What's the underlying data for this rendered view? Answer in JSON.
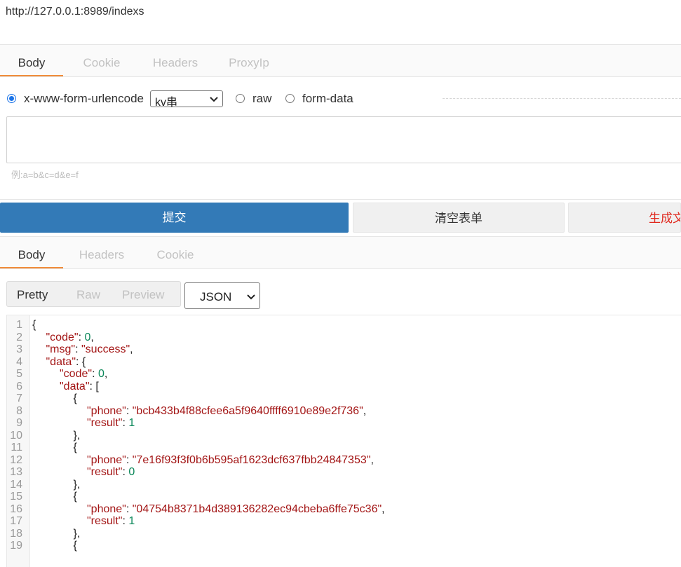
{
  "url": "http://127.0.0.1:8989/indexs",
  "request_tabs": [
    "Body",
    "Cookie",
    "Headers",
    "ProxyIp"
  ],
  "body_options": {
    "urlencode_label": "x-www-form-urlencode",
    "urlencode_select_value": "kv串",
    "raw_label": "raw",
    "formdata_label": "form-data"
  },
  "textarea_hint": "例:a=b&c=d&e=f",
  "buttons": {
    "submit": "提交",
    "clear": "清空表单",
    "generate": "生成文"
  },
  "response_tabs": [
    "Body",
    "Headers",
    "Cookie"
  ],
  "view_modes": [
    "Pretty",
    "Raw",
    "Preview"
  ],
  "format_select_value": "JSON",
  "colors": {
    "primary": "#337ab7",
    "tab_underline": "#f08c3a",
    "danger_text": "#e0281d",
    "json_key": "#a31515",
    "json_number": "#098658"
  },
  "code_lines": [
    {
      "n": "1",
      "indent": 0,
      "parts": [
        [
          "p",
          "{"
        ]
      ]
    },
    {
      "n": "2",
      "indent": 1,
      "parts": [
        [
          "k",
          "\"code\""
        ],
        [
          "p",
          ": "
        ],
        [
          "n",
          "0"
        ],
        [
          "p",
          ","
        ]
      ]
    },
    {
      "n": "3",
      "indent": 1,
      "parts": [
        [
          "k",
          "\"msg\""
        ],
        [
          "p",
          ": "
        ],
        [
          "s",
          "\"success\""
        ],
        [
          "p",
          ","
        ]
      ]
    },
    {
      "n": "4",
      "indent": 1,
      "parts": [
        [
          "k",
          "\"data\""
        ],
        [
          "p",
          ": {"
        ]
      ]
    },
    {
      "n": "5",
      "indent": 2,
      "parts": [
        [
          "k",
          "\"code\""
        ],
        [
          "p",
          ": "
        ],
        [
          "n",
          "0"
        ],
        [
          "p",
          ","
        ]
      ]
    },
    {
      "n": "6",
      "indent": 2,
      "parts": [
        [
          "k",
          "\"data\""
        ],
        [
          "p",
          ": ["
        ]
      ]
    },
    {
      "n": "7",
      "indent": 3,
      "parts": [
        [
          "p",
          "{"
        ]
      ]
    },
    {
      "n": "8",
      "indent": 4,
      "parts": [
        [
          "k",
          "\"phone\""
        ],
        [
          "p",
          ": "
        ],
        [
          "s",
          "\"bcb433b4f88cfee6a5f9640ffff6910e89e2f736\""
        ],
        [
          "p",
          ","
        ]
      ]
    },
    {
      "n": "9",
      "indent": 4,
      "parts": [
        [
          "k",
          "\"result\""
        ],
        [
          "p",
          ": "
        ],
        [
          "n",
          "1"
        ]
      ]
    },
    {
      "n": "10",
      "indent": 3,
      "parts": [
        [
          "p",
          "},"
        ]
      ]
    },
    {
      "n": "11",
      "indent": 3,
      "parts": [
        [
          "p",
          "{"
        ]
      ]
    },
    {
      "n": "12",
      "indent": 4,
      "parts": [
        [
          "k",
          "\"phone\""
        ],
        [
          "p",
          ": "
        ],
        [
          "s",
          "\"7e16f93f3f0b6b595af1623dcf637fbb24847353\""
        ],
        [
          "p",
          ","
        ]
      ]
    },
    {
      "n": "13",
      "indent": 4,
      "parts": [
        [
          "k",
          "\"result\""
        ],
        [
          "p",
          ": "
        ],
        [
          "n",
          "0"
        ]
      ]
    },
    {
      "n": "14",
      "indent": 3,
      "parts": [
        [
          "p",
          "},"
        ]
      ]
    },
    {
      "n": "15",
      "indent": 3,
      "parts": [
        [
          "p",
          "{"
        ]
      ]
    },
    {
      "n": "16",
      "indent": 4,
      "parts": [
        [
          "k",
          "\"phone\""
        ],
        [
          "p",
          ": "
        ],
        [
          "s",
          "\"04754b8371b4d389136282ec94cbeba6ffe75c36\""
        ],
        [
          "p",
          ","
        ]
      ]
    },
    {
      "n": "17",
      "indent": 4,
      "parts": [
        [
          "k",
          "\"result\""
        ],
        [
          "p",
          ": "
        ],
        [
          "n",
          "1"
        ]
      ]
    },
    {
      "n": "18",
      "indent": 3,
      "parts": [
        [
          "p",
          "},"
        ]
      ]
    },
    {
      "n": "19",
      "indent": 3,
      "parts": [
        [
          "p",
          "{"
        ]
      ]
    }
  ]
}
